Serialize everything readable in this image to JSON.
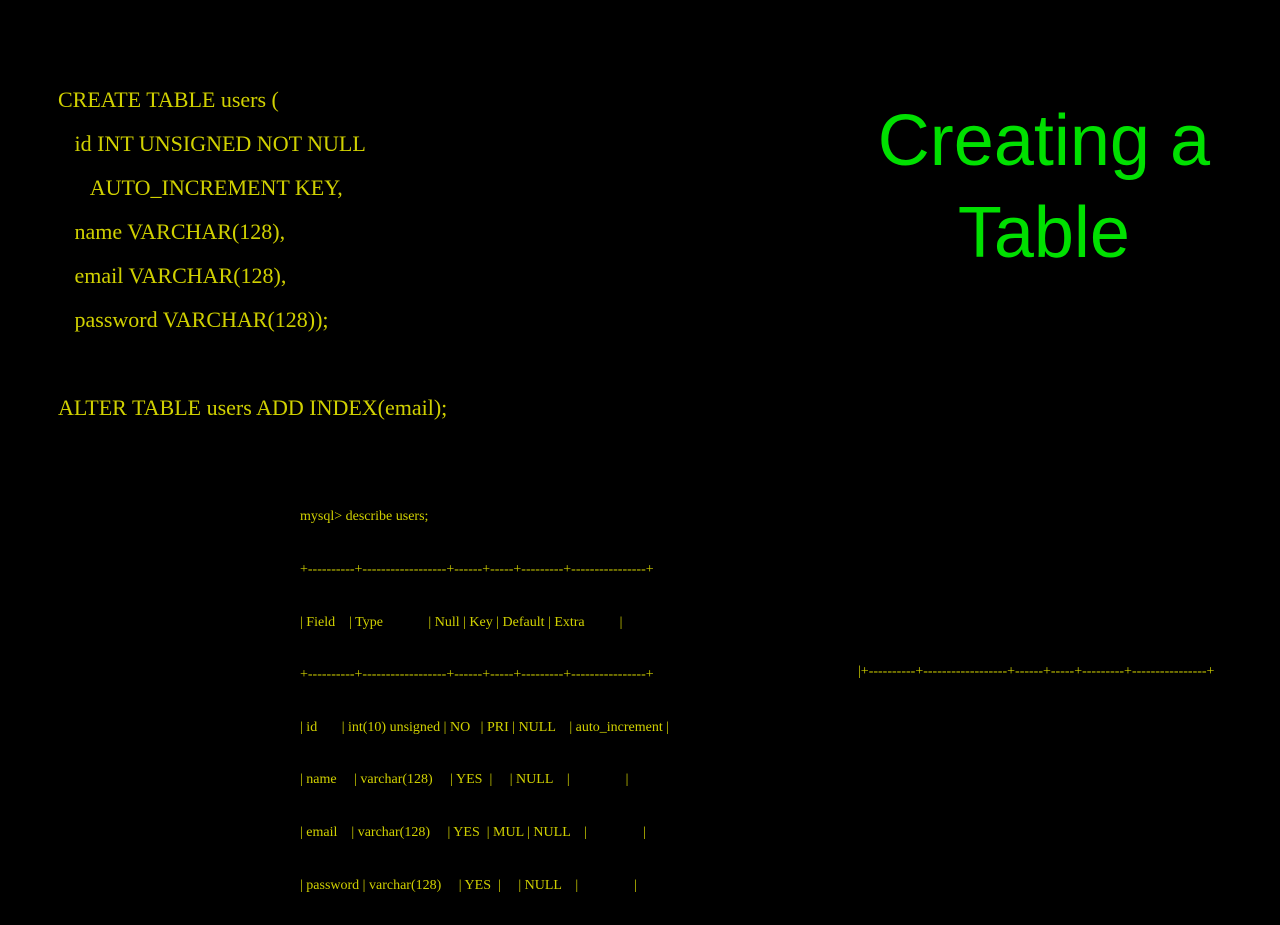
{
  "title": {
    "line1": "Creating a",
    "line2": "Table"
  },
  "sql": {
    "l1": "CREATE TABLE users (",
    "l2": "   id INT UNSIGNED NOT NULL",
    "l3": "      AUTO_INCREMENT KEY,",
    "l4": "   name VARCHAR(128),",
    "l5": "   email VARCHAR(128),",
    "l6": "   password VARCHAR(128));",
    "l7": "ALTER TABLE users ADD INDEX(email);"
  },
  "term": {
    "l1": "mysql> describe users;",
    "l2": "+----------+------------------+------+-----+---------+----------------+",
    "l3": "| Field    | Type             | Null | Key | Default | Extra          |",
    "l4": "+----------+------------------+------+-----+---------+----------------+",
    "l5": "| id       | int(10) unsigned | NO   | PRI | NULL    | auto_increment |",
    "l6": "| name     | varchar(128)     | YES  |     | NULL    |                |",
    "l7": "| email    | varchar(128)     | YES  | MUL | NULL    |                |",
    "l8": "| password | varchar(128)     | YES  |     | NULL    |                |"
  },
  "overflow": "|+----------+------------------+------+-----+---------+----------------+"
}
